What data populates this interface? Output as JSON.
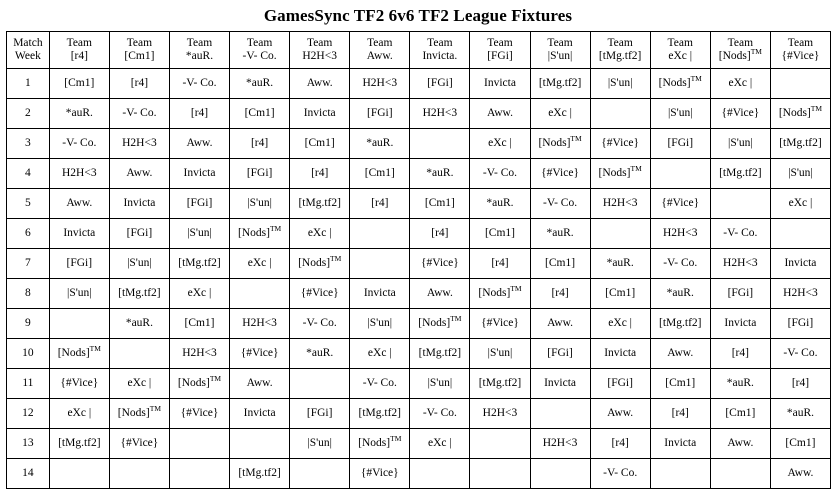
{
  "document": {
    "title": "GamesSync TF2 6v6 TF2 League Fixtures"
  },
  "table": {
    "highlight_color": "#e9c877",
    "highlight_text_color": "#7d5a16",
    "highlight_column_index": 4,
    "headers": [
      {
        "line1": "Match",
        "line2": "Week"
      },
      {
        "line1": "Team",
        "line2": "[r4]"
      },
      {
        "line1": "Team",
        "line2": "[Cm1]"
      },
      {
        "line1": "Team",
        "line2": "*auR."
      },
      {
        "line1": "Team",
        "line2": "-V- Co."
      },
      {
        "line1": "Team",
        "line2": "H2H<3"
      },
      {
        "line1": "Team",
        "line2": "Aww."
      },
      {
        "line1": "Team",
        "line2": "Invicta."
      },
      {
        "line1": "Team",
        "line2": "[FGi]"
      },
      {
        "line1": "Team",
        "line2": "|S'un|"
      },
      {
        "line1": "Team",
        "line2": "[tMg.tf2]"
      },
      {
        "line1": "Team",
        "line2": "eXc |"
      },
      {
        "line1": "Team",
        "line2": "[Nods]TM",
        "sup": "TM",
        "base": "[Nods]"
      },
      {
        "line1": "Team",
        "line2": "{#Vice}"
      }
    ],
    "rows": [
      {
        "week": "1",
        "cells": [
          "[Cm1]",
          "[r4]",
          "-V- Co.",
          "*auR.",
          "Aww.",
          "H2H<3",
          "[FGi]",
          "Invicta",
          "[tMg.tf2]",
          "|S'un|",
          "[Nods]TM",
          "eXc |",
          ""
        ]
      },
      {
        "week": "2",
        "cells": [
          "*auR.",
          "-V- Co.",
          "[r4]",
          "[Cm1]",
          "Invicta",
          "[FGi]",
          "H2H<3",
          "Aww.",
          "eXc |",
          "",
          "|S'un|",
          "{#Vice}",
          "[Nods]TM"
        ]
      },
      {
        "week": "3",
        "cells": [
          "-V- Co.",
          "H2H<3",
          "Aww.",
          "[r4]",
          "[Cm1]",
          "*auR.",
          "",
          "eXc |",
          "[Nods]TM",
          "{#Vice}",
          "[FGi]",
          "|S'un|",
          "[tMg.tf2]"
        ]
      },
      {
        "week": "4",
        "cells": [
          "H2H<3",
          "Aww.",
          "Invicta",
          "[FGi]",
          "[r4]",
          "[Cm1]",
          "*auR.",
          "-V- Co.",
          "{#Vice}",
          "[Nods]TM",
          "",
          "[tMg.tf2]",
          "|S'un|"
        ]
      },
      {
        "week": "5",
        "cells": [
          "Aww.",
          "Invicta",
          "[FGi]",
          "|S'un|",
          "[tMg.tf2]",
          "[r4]",
          "[Cm1]",
          "*auR.",
          "-V- Co.",
          "H2H<3",
          "{#Vice}",
          "",
          "eXc |"
        ]
      },
      {
        "week": "6",
        "cells": [
          "Invicta",
          "[FGi]",
          "|S'un|",
          "[Nods]TM",
          "eXc |",
          "",
          "[r4]",
          "[Cm1]",
          "*auR.",
          "",
          "H2H<3",
          "-V- Co.",
          ""
        ]
      },
      {
        "week": "7",
        "cells": [
          "[FGi]",
          "|S'un|",
          "[tMg.tf2]",
          "eXc |",
          "[Nods]TM",
          "",
          "{#Vice}",
          "[r4]",
          "[Cm1]",
          "*auR.",
          "-V- Co.",
          "H2H<3",
          "Invicta"
        ]
      },
      {
        "week": "8",
        "cells": [
          "|S'un|",
          "[tMg.tf2]",
          "eXc |",
          "",
          "{#Vice}",
          "Invicta",
          "Aww.",
          "[Nods]TM",
          "[r4]",
          "[Cm1]",
          "*auR.",
          "[FGi]",
          "H2H<3"
        ]
      },
      {
        "week": "9",
        "cells": [
          "",
          "*auR.",
          "[Cm1]",
          "H2H<3",
          "-V- Co.",
          "|S'un|",
          "[Nods]TM",
          "{#Vice}",
          "Aww.",
          "eXc |",
          "[tMg.tf2]",
          "Invicta",
          "[FGi]"
        ]
      },
      {
        "week": "10",
        "cells": [
          "[Nods]TM",
          "",
          "H2H<3",
          "{#Vice}",
          "*auR.",
          "eXc |",
          "[tMg.tf2]",
          "|S'un|",
          "[FGi]",
          "Invicta",
          "Aww.",
          "[r4]",
          "-V- Co."
        ]
      },
      {
        "week": "11",
        "cells": [
          "{#Vice}",
          "eXc |",
          "[Nods]TM",
          "Aww.",
          "",
          "-V- Co.",
          "|S'un|",
          "[tMg.tf2]",
          "Invicta",
          "[FGi]",
          "[Cm1]",
          "*auR.",
          "[r4]"
        ]
      },
      {
        "week": "12",
        "cells": [
          "eXc |",
          "[Nods]TM",
          "{#Vice}",
          "Invicta",
          "[FGi]",
          "[tMg.tf2]",
          "-V- Co.",
          "H2H<3",
          "",
          "Aww.",
          "[r4]",
          "[Cm1]",
          "*auR."
        ]
      },
      {
        "week": "13",
        "cells": [
          "[tMg.tf2]",
          "{#Vice}",
          "",
          "",
          "|S'un|",
          "[Nods]TM",
          "eXc |",
          "",
          "H2H<3",
          "[r4]",
          "Invicta",
          "Aww.",
          "[Cm1]"
        ]
      },
      {
        "week": "14",
        "cells": [
          "",
          "",
          "",
          "[tMg.tf2]",
          "",
          "{#Vice}",
          "",
          "",
          "",
          "-V- Co.",
          "",
          "",
          "Aww."
        ]
      }
    ]
  }
}
